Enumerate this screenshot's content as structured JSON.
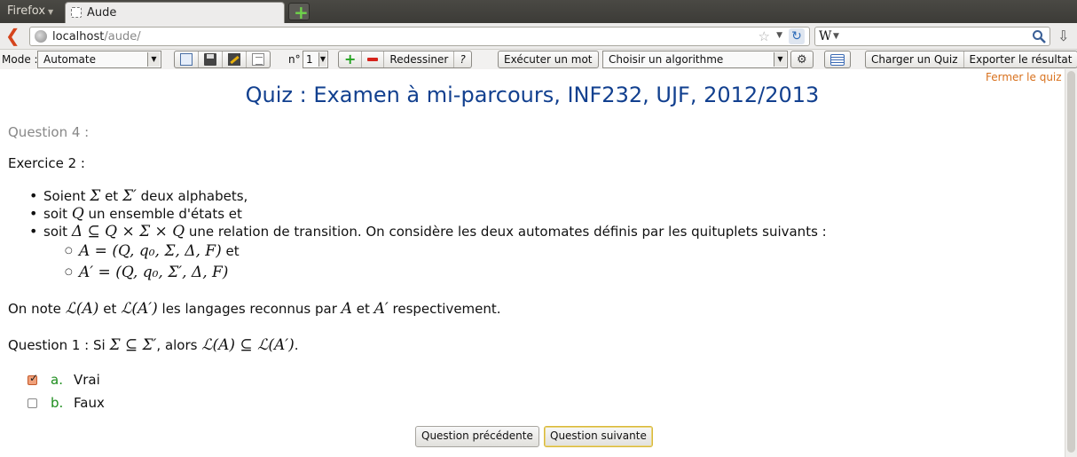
{
  "browser": {
    "menu_label": "Firefox",
    "tab_title": "Aude",
    "url_host": "localhost",
    "url_path": "/aude/",
    "search_engine": "W"
  },
  "toolbar": {
    "mode_label": "Mode :",
    "mode_value": "Automate",
    "number_label": "n°",
    "number_value": "1",
    "redraw_label": "Redessiner",
    "pen_label": "?",
    "run_word_label": "Exécuter un mot",
    "algo_placeholder": "Choisir un algorithme",
    "load_quiz_label": "Charger un Quiz",
    "export_label": "Exporter le résultat"
  },
  "quiz": {
    "close_label": "Fermer le quiz",
    "title": "Quiz : Examen à mi-parcours, INF232, UJF, 2012/2013",
    "question_number": "Question 4 :",
    "exercise": "Exercice 2 :",
    "bullets": [
      {
        "pre": "Soient ",
        "math1": "Σ",
        "mid": " et ",
        "math2": "Σ′",
        "post": " deux alphabets,"
      },
      {
        "pre": "soit ",
        "math1": "Q",
        "post": " un ensemble d'états et"
      },
      {
        "pre": "soit ",
        "math1": "Δ ⊆ Q × Σ × Q",
        "post": " une relation de transition. On considère les deux automates définis par les quituplets suivants :"
      }
    ],
    "sub_bullets": [
      {
        "math": "A = (Q, q₀, Σ, Δ, F)",
        "post": " et"
      },
      {
        "math": "A′ = (Q, q₀, Σ′, Δ, F)",
        "post": ""
      }
    ],
    "note": {
      "pre": "On note ",
      "m1": "ℒ(A)",
      "t1": " et ",
      "m2": "ℒ(A′)",
      "t2": " les langages reconnus par ",
      "m3": "A",
      "t3": " et ",
      "m4": "A′",
      "t4": " respectivement."
    },
    "question_line": {
      "pre": "Question 1 : Si ",
      "m1": "Σ ⊆ Σ′",
      "t1": ", alors ",
      "m2": "ℒ(A) ⊆ ℒ(A′)",
      "t2": "."
    },
    "answers": [
      {
        "letter": "a.",
        "text": "Vrai",
        "checked": true
      },
      {
        "letter": "b.",
        "text": "Faux",
        "checked": false
      }
    ],
    "prev_label": "Question précédente",
    "next_label": "Question suivante"
  },
  "colors": {
    "title": "#12408f",
    "accent_link": "#d8711d",
    "answer_letter": "#1d8d1d"
  }
}
